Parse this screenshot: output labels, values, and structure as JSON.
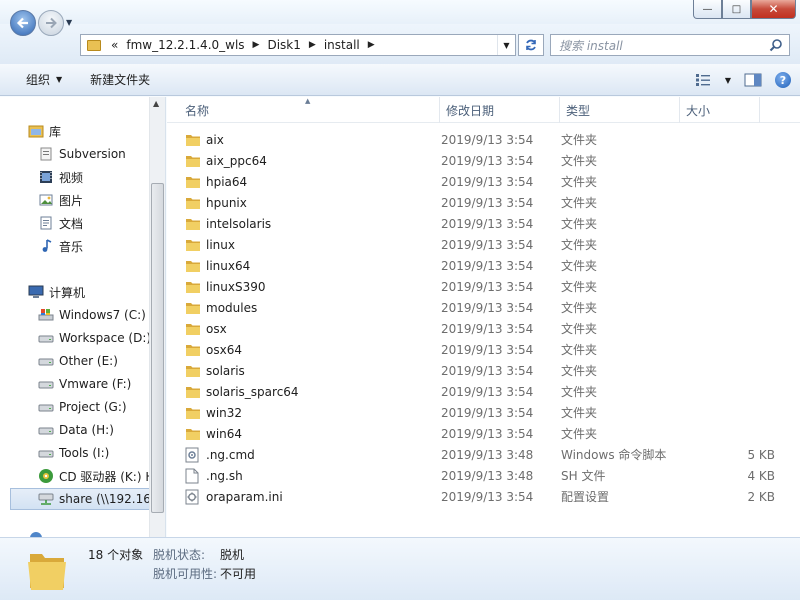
{
  "window": {
    "minimize": "—",
    "maximize": "□",
    "close": "✕"
  },
  "address": {
    "overflow": "«",
    "crumbs": [
      "fmw_12.2.1.4.0_wls",
      "Disk1",
      "install"
    ]
  },
  "search": {
    "placeholder": "搜索 install"
  },
  "toolbar": {
    "organize": "组织",
    "new_folder": "新建文件夹"
  },
  "sidebar": {
    "items": [
      {
        "label": "库",
        "icon": "library-icon",
        "level": 0
      },
      {
        "label": "Subversion",
        "icon": "svn-library-icon",
        "level": 1
      },
      {
        "label": "视频",
        "icon": "video-library-icon",
        "level": 1
      },
      {
        "label": "图片",
        "icon": "picture-library-icon",
        "level": 1
      },
      {
        "label": "文档",
        "icon": "document-library-icon",
        "level": 1
      },
      {
        "label": "音乐",
        "icon": "music-library-icon",
        "level": 1
      },
      {
        "label": "计算机",
        "icon": "computer-icon",
        "level": 0
      },
      {
        "label": "Windows7 (C:)",
        "icon": "windows-drive-icon",
        "level": 1
      },
      {
        "label": "Workspace (D:)",
        "icon": "drive-icon",
        "level": 1
      },
      {
        "label": "Other (E:)",
        "icon": "drive-icon",
        "level": 1
      },
      {
        "label": "Vmware (F:)",
        "icon": "drive-icon",
        "level": 1
      },
      {
        "label": "Project (G:)",
        "icon": "drive-icon",
        "level": 1
      },
      {
        "label": "Data (H:)",
        "icon": "drive-icon",
        "level": 1
      },
      {
        "label": "Tools (I:)",
        "icon": "drive-icon",
        "level": 1
      },
      {
        "label": "CD 驱动器 (K:) H",
        "icon": "cd-drive-icon",
        "level": 1
      },
      {
        "label": "share (\\\\192.16",
        "icon": "network-drive-icon",
        "level": 1,
        "selected": true
      }
    ]
  },
  "columns": {
    "name": "名称",
    "modified": "修改日期",
    "type": "类型",
    "size": "大小"
  },
  "files": [
    {
      "name": "aix",
      "date": "2019/9/13 3:54",
      "type": "文件夹",
      "size": "",
      "kind": "folder"
    },
    {
      "name": "aix_ppc64",
      "date": "2019/9/13 3:54",
      "type": "文件夹",
      "size": "",
      "kind": "folder"
    },
    {
      "name": "hpia64",
      "date": "2019/9/13 3:54",
      "type": "文件夹",
      "size": "",
      "kind": "folder"
    },
    {
      "name": "hpunix",
      "date": "2019/9/13 3:54",
      "type": "文件夹",
      "size": "",
      "kind": "folder"
    },
    {
      "name": "intelsolaris",
      "date": "2019/9/13 3:54",
      "type": "文件夹",
      "size": "",
      "kind": "folder"
    },
    {
      "name": "linux",
      "date": "2019/9/13 3:54",
      "type": "文件夹",
      "size": "",
      "kind": "folder"
    },
    {
      "name": "linux64",
      "date": "2019/9/13 3:54",
      "type": "文件夹",
      "size": "",
      "kind": "folder"
    },
    {
      "name": "linuxS390",
      "date": "2019/9/13 3:54",
      "type": "文件夹",
      "size": "",
      "kind": "folder"
    },
    {
      "name": "modules",
      "date": "2019/9/13 3:54",
      "type": "文件夹",
      "size": "",
      "kind": "folder"
    },
    {
      "name": "osx",
      "date": "2019/9/13 3:54",
      "type": "文件夹",
      "size": "",
      "kind": "folder"
    },
    {
      "name": "osx64",
      "date": "2019/9/13 3:54",
      "type": "文件夹",
      "size": "",
      "kind": "folder"
    },
    {
      "name": "solaris",
      "date": "2019/9/13 3:54",
      "type": "文件夹",
      "size": "",
      "kind": "folder"
    },
    {
      "name": "solaris_sparc64",
      "date": "2019/9/13 3:54",
      "type": "文件夹",
      "size": "",
      "kind": "folder"
    },
    {
      "name": "win32",
      "date": "2019/9/13 3:54",
      "type": "文件夹",
      "size": "",
      "kind": "folder"
    },
    {
      "name": "win64",
      "date": "2019/9/13 3:54",
      "type": "文件夹",
      "size": "",
      "kind": "folder"
    },
    {
      "name": ".ng.cmd",
      "date": "2019/9/13 3:48",
      "type": "Windows 命令脚本",
      "size": "5 KB",
      "kind": "cmd"
    },
    {
      "name": ".ng.sh",
      "date": "2019/9/13 3:48",
      "type": "SH 文件",
      "size": "4 KB",
      "kind": "file"
    },
    {
      "name": "oraparam.ini",
      "date": "2019/9/13 3:54",
      "type": "配置设置",
      "size": "2 KB",
      "kind": "ini"
    }
  ],
  "details": {
    "count": "18 个对象",
    "offline_status_label": "脱机状态:",
    "offline_status_value": "脱机",
    "offline_avail_label": "脱机可用性:",
    "offline_avail_value": "不可用"
  },
  "colors": {
    "folder": "#e9c053",
    "accent": "#3468b8",
    "selection": "#d3e2f3"
  }
}
